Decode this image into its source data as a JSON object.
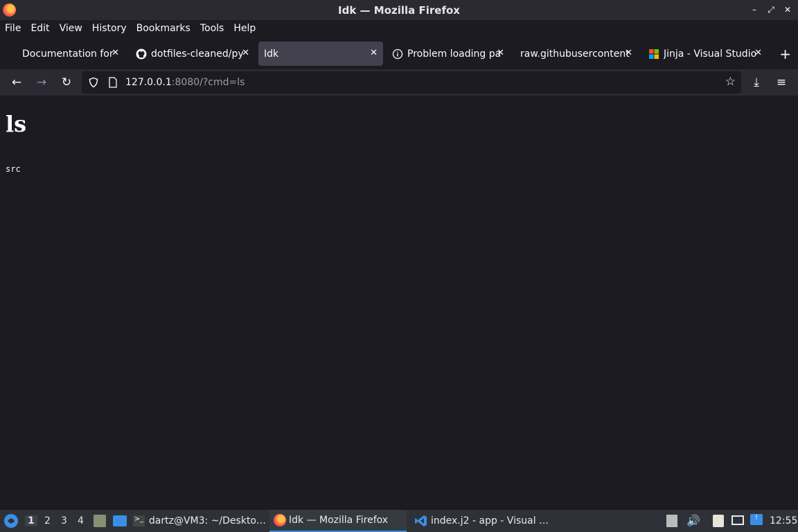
{
  "window": {
    "title": "Idk — Mozilla Firefox"
  },
  "menu": [
    "File",
    "Edit",
    "View",
    "History",
    "Bookmarks",
    "Tools",
    "Help"
  ],
  "tabs": [
    {
      "title": "Documentation for",
      "icon": "none"
    },
    {
      "title": "dotfiles-cleaned/py",
      "icon": "github-icon"
    },
    {
      "title": "Idk",
      "icon": "none",
      "active": true
    },
    {
      "title": "Problem loading pa",
      "icon": "info-icon"
    },
    {
      "title": "raw.githubusercontent",
      "icon": "none"
    },
    {
      "title": "Jinja - Visual Studio",
      "icon": "microsoft-icon"
    }
  ],
  "url": {
    "host": "127.0.0.1",
    "rest": ":8080/?cmd=ls"
  },
  "page": {
    "heading": "ls",
    "output": "src"
  },
  "taskbar": {
    "workspaces": [
      "1",
      "2",
      "3",
      "4"
    ],
    "tasks": [
      {
        "label": "dartz@VM3: ~/Deskto…",
        "icon": "terminal-icon"
      },
      {
        "label": "Idk — Mozilla Firefox",
        "icon": "firefox-icon",
        "active": true
      },
      {
        "label": "index.j2 - app - Visual …",
        "icon": "vscode-icon"
      }
    ],
    "clock": "12:55"
  },
  "colors": {
    "accent": "#3a8ee6",
    "background": "#1c1b22",
    "toolbar": "#2b2a33"
  }
}
